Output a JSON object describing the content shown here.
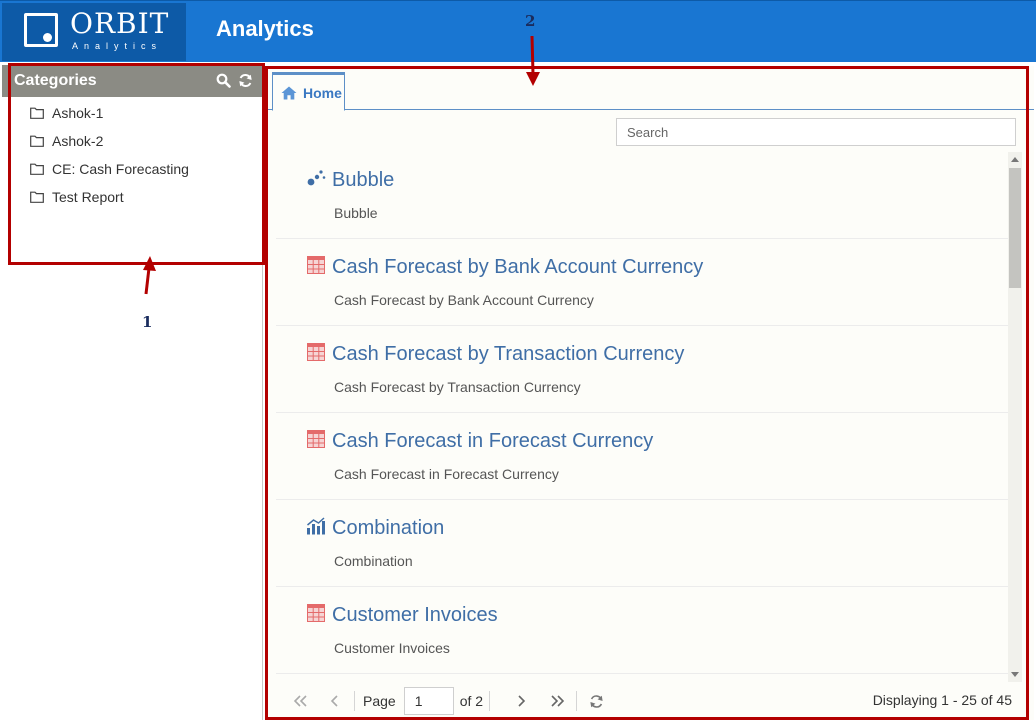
{
  "header": {
    "logo_word": "ORBIT",
    "logo_sub": "Analytics",
    "title": "Analytics",
    "color": "#1976d2"
  },
  "categories": {
    "title": "Categories",
    "search_icon": "search-icon",
    "refresh_icon": "refresh-icon",
    "items": [
      {
        "label": "Ashok-1",
        "icon": "folder-icon"
      },
      {
        "label": "Ashok-2",
        "icon": "folder-icon"
      },
      {
        "label": "CE: Cash Forecasting",
        "icon": "folder-icon"
      },
      {
        "label": "Test Report",
        "icon": "folder-icon"
      }
    ]
  },
  "main": {
    "tabs": [
      {
        "label": "Home",
        "icon": "home-icon"
      }
    ],
    "search": {
      "placeholder": "Search",
      "value": ""
    },
    "reports": [
      {
        "title": "Bubble",
        "description": "Bubble",
        "icon": "bubble-chart-icon"
      },
      {
        "title": "Cash Forecast by Bank Account Currency",
        "description": "Cash Forecast by Bank Account Currency",
        "icon": "table-icon"
      },
      {
        "title": "Cash Forecast by Transaction Currency",
        "description": "Cash Forecast by Transaction Currency",
        "icon": "table-icon"
      },
      {
        "title": "Cash Forecast in Forecast Currency",
        "description": "Cash Forecast in Forecast Currency",
        "icon": "table-icon"
      },
      {
        "title": "Combination",
        "description": "Combination",
        "icon": "combination-chart-icon"
      },
      {
        "title": "Customer Invoices",
        "description": "Customer Invoices",
        "icon": "table-icon"
      }
    ],
    "pager": {
      "page_label": "Page",
      "current_page": "1",
      "of_label": "of 2",
      "display_info": "Displaying 1 - 25 of 45"
    }
  },
  "annotations": {
    "label_1": "1",
    "label_2": "2",
    "color": "#b30000"
  }
}
